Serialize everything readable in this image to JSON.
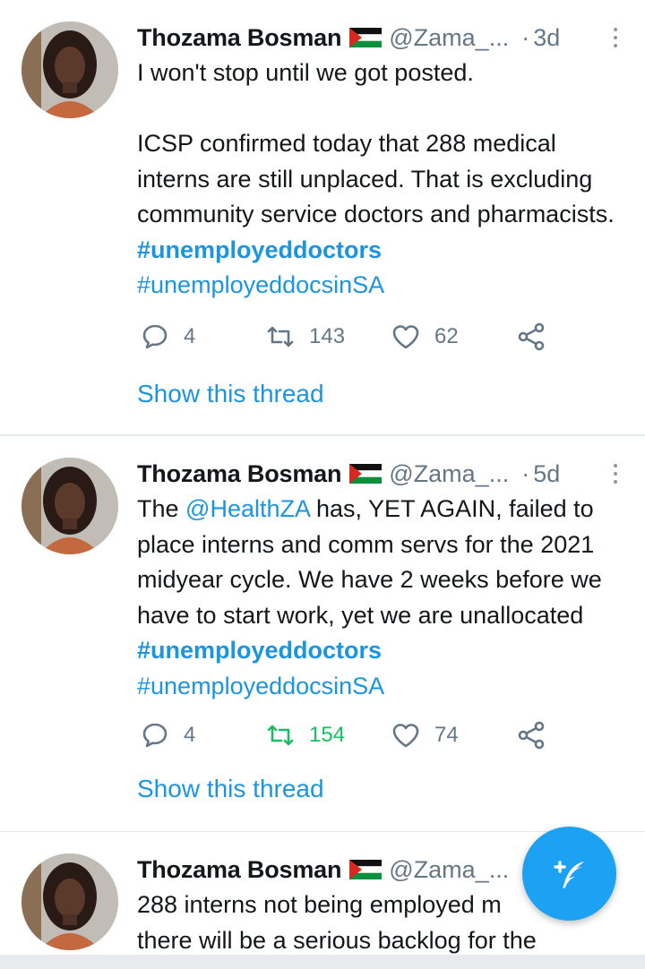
{
  "tweets": [
    {
      "name": "Thozama Bosman",
      "handle": "@Zama_...",
      "dot": "·",
      "time": "3d",
      "text_parts": [
        "I won't stop until we got posted.\n\nICSP confirmed today that 288 medical interns are still unplaced. That is excluding community service doctors and pharmacists. "
      ],
      "hashtag_bold": "#unemployeddoctors",
      "hashtag_2": "#unemployeddocsinSA",
      "replies": "4",
      "retweets": "143",
      "likes": "62",
      "thread_label": "Show this thread"
    },
    {
      "name": "Thozama Bosman",
      "handle": "@Zama_...",
      "dot": "·",
      "time": "5d",
      "text_before": "The ",
      "mention": "@HealthZA",
      "text_after": " has, YET AGAIN, failed to place interns and comm servs for the 2021 midyear cycle. We have 2 weeks before we have to start work, yet we are unallocated ",
      "hashtag_bold": "#unemployeddoctors",
      "hashtag_2": "#unemployeddocsinSA",
      "replies": "4",
      "retweets": "154",
      "likes": "74",
      "thread_label": "Show this thread"
    },
    {
      "name": "Thozama Bosman",
      "handle": "@Zama_...",
      "text": "288 interns not being employed m\nthere will be a serious backlog for the"
    }
  ],
  "icons": {
    "reply": "reply-icon",
    "retweet": "retweet-icon",
    "like": "heart-icon",
    "share": "share-icon",
    "more": "more-vertical-icon",
    "compose": "compose-tweet-icon",
    "flag": "palestine-flag-icon"
  },
  "colors": {
    "link": "#1b95e0",
    "muted": "#657786",
    "retweet_active": "#17bf63",
    "fab": "#1da1f2"
  }
}
